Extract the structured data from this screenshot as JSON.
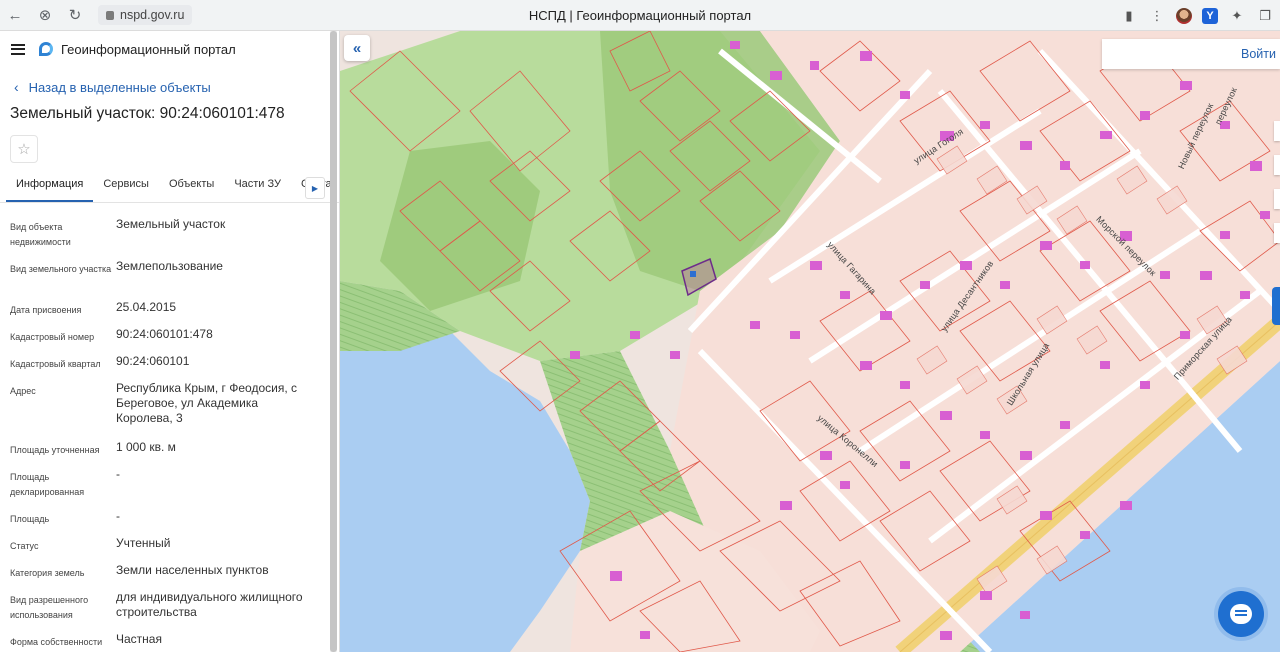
{
  "browser": {
    "url": "nspd.gov.ru",
    "tab_title": "НСПД | Геоинформационный портал"
  },
  "header": {
    "portal_name": "Геоинформационный портал"
  },
  "panel": {
    "back_label": "Назад в выделенные объекты",
    "title": "Земельный участок: 90:24:060101:478",
    "tabs": [
      {
        "label": "Информация",
        "active": true
      },
      {
        "label": "Сервисы"
      },
      {
        "label": "Объекты"
      },
      {
        "label": "Части ЗУ"
      },
      {
        "label": "Соста"
      }
    ],
    "properties": [
      {
        "key": "Вид объекта недвижимости",
        "value": "Земельный участок"
      },
      {
        "key": "Вид земельного участка",
        "value": "Землепользование"
      },
      {
        "key": "Дата присвоения",
        "value": "25.04.2015"
      },
      {
        "key": "Кадастровый номер",
        "value": "90:24:060101:478"
      },
      {
        "key": "Кадастровый квартал",
        "value": "90:24:060101"
      },
      {
        "key": "Адрес",
        "value": "Республика Крым, г Феодосия, с Береговое, ул Академика Королева, 3"
      },
      {
        "key": "Площадь уточненная",
        "value": "1 000 кв. м"
      },
      {
        "key": "Площадь декларированная",
        "value": "-"
      },
      {
        "key": "Площадь",
        "value": "-"
      },
      {
        "key": "Статус",
        "value": "Учтенный"
      },
      {
        "key": "Категория земель",
        "value": "Земли населенных пунктов"
      },
      {
        "key": "Вид разрешенного использования",
        "value": "для индивидуального жилищного строительства"
      },
      {
        "key": "Форма собственности",
        "value": "Частная"
      }
    ]
  },
  "map": {
    "login_label": "Войти",
    "streets": [
      "улица Гоголя",
      "улица Гагарина",
      "улица Десантников",
      "Школьная улица",
      "улица Коронелли",
      "Морской переулок",
      "Приморская улица",
      "Новый переулок",
      "переулок"
    ],
    "colors": {
      "parcel_fill": "#f6ddd6",
      "parcel_stroke": "#e05a4a",
      "green": "#a9d58a",
      "water": "#a9cdf4",
      "building": "#d95bd4",
      "road": "#f4d775"
    }
  }
}
